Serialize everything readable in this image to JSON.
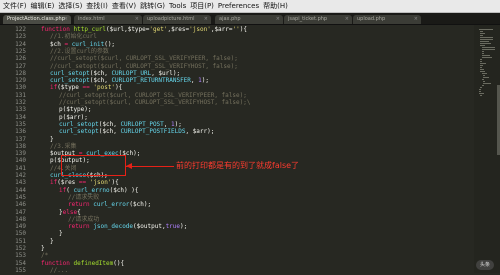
{
  "menu": [
    "文件(F)",
    "编辑(E)",
    "选择(S)",
    "查找(I)",
    "查看(V)",
    "跳转(G)",
    "Tools",
    "项目(P)",
    "Preferences",
    "帮助(H)"
  ],
  "tabs": [
    {
      "label": "ProjectAction.class.php",
      "active": true
    },
    {
      "label": "index.html",
      "active": false
    },
    {
      "label": "uploadpicture.html",
      "active": false
    },
    {
      "label": "ajax.php",
      "active": false
    },
    {
      "label": "jsapi_ticket.php",
      "active": false
    },
    {
      "label": "upload.php",
      "active": false
    }
  ],
  "line_numbers": [
    "122",
    "123",
    "124",
    "125",
    "126",
    "127",
    "128",
    "129",
    "130",
    "131",
    "132",
    "133",
    "134",
    "135",
    "136",
    "137",
    "138",
    "139",
    "140",
    "141",
    "142",
    "143",
    "144",
    "145",
    "146",
    "147",
    "148",
    "149",
    "150",
    "151",
    "152",
    "153",
    "154",
    "155"
  ],
  "code": [
    {
      "indent": 1,
      "parts": [
        [
          "k",
          "function "
        ],
        [
          "fn",
          "http_curl"
        ],
        [
          "p",
          "($url,$type="
        ],
        [
          "s",
          "'get'"
        ],
        [
          "p",
          ",$res="
        ],
        [
          "s",
          "'json'"
        ],
        [
          "p",
          ",$arr="
        ],
        [
          "s",
          "''"
        ],
        [
          "p",
          "){"
        ]
      ]
    },
    {
      "indent": 2,
      "parts": [
        [
          "c",
          "//1.初始化curl"
        ]
      ]
    },
    {
      "indent": 2,
      "parts": [
        [
          "v",
          "$ch "
        ],
        [
          "k",
          "= "
        ],
        [
          "f",
          "curl_init"
        ],
        [
          "p",
          "();"
        ]
      ]
    },
    {
      "indent": 2,
      "parts": [
        [
          "c",
          "//2.设置curl的参数"
        ]
      ]
    },
    {
      "indent": 2,
      "parts": [
        [
          "c",
          "//curl_setopt($curl, CURLOPT_SSL_VERIFYPEER, false);"
        ]
      ]
    },
    {
      "indent": 2,
      "parts": [
        [
          "c",
          "//curl_setopt($curl, CURLOPT_SSL_VERIFYHOST, false);"
        ]
      ]
    },
    {
      "indent": 2,
      "parts": [
        [
          "f",
          "curl_setopt"
        ],
        [
          "p",
          "($ch, "
        ],
        [
          "f",
          "CURLOPT_URL"
        ],
        [
          "p",
          ", $url);"
        ]
      ]
    },
    {
      "indent": 2,
      "parts": [
        [
          "f",
          "curl_setopt"
        ],
        [
          "p",
          "($ch, "
        ],
        [
          "f",
          "CURLOPT_RETURNTRANSFER"
        ],
        [
          "p",
          ", "
        ],
        [
          "n",
          "1"
        ],
        [
          "p",
          ");"
        ]
      ]
    },
    {
      "indent": 2,
      "parts": [
        [
          "k",
          "if"
        ],
        [
          "p",
          "($type "
        ],
        [
          "k",
          "== "
        ],
        [
          "s",
          "'post'"
        ],
        [
          "p",
          "){"
        ]
      ]
    },
    {
      "indent": 3,
      "parts": [
        [
          "c",
          "//curl_setopt($curl, CURLOPT_SSL_VERIFYPEER, false);"
        ]
      ]
    },
    {
      "indent": 3,
      "parts": [
        [
          "c",
          "//curl_setopt($curl, CURLOPT_SSL_VERIFYHOST, false);\\"
        ]
      ]
    },
    {
      "indent": 3,
      "parts": [
        [
          "v",
          "p($type);"
        ]
      ]
    },
    {
      "indent": 3,
      "parts": [
        [
          "v",
          "p($arr);"
        ]
      ]
    },
    {
      "indent": 3,
      "parts": [
        [
          "f",
          "curl_setopt"
        ],
        [
          "p",
          "($ch, "
        ],
        [
          "f",
          "CURLOPT_POST"
        ],
        [
          "p",
          ", "
        ],
        [
          "n",
          "1"
        ],
        [
          "p",
          ");"
        ]
      ]
    },
    {
      "indent": 3,
      "parts": [
        [
          "f",
          "curl_setopt"
        ],
        [
          "p",
          "($ch, "
        ],
        [
          "f",
          "CURLOPT_POSTFIELDS"
        ],
        [
          "p",
          ", $arr);"
        ]
      ]
    },
    {
      "indent": 2,
      "parts": [
        [
          "p",
          "}"
        ]
      ]
    },
    {
      "indent": 2,
      "parts": [
        [
          "c",
          "//3.采集"
        ]
      ]
    },
    {
      "indent": 2,
      "parts": [
        [
          "v",
          "$output "
        ],
        [
          "k",
          "= "
        ],
        [
          "f",
          "curl_exec"
        ],
        [
          "p",
          "($ch);"
        ]
      ]
    },
    {
      "indent": 2,
      "parts": [
        [
          "v",
          "p($output);"
        ]
      ]
    },
    {
      "indent": 2,
      "parts": [
        [
          "c",
          "//4.关闭"
        ]
      ]
    },
    {
      "indent": 2,
      "parts": [
        [
          "f",
          "curl_close"
        ],
        [
          "p",
          "($ch);"
        ]
      ]
    },
    {
      "indent": 2,
      "parts": [
        [
          "k",
          "if"
        ],
        [
          "p",
          "($res "
        ],
        [
          "k",
          "== "
        ],
        [
          "s",
          "'json'"
        ],
        [
          "p",
          "){"
        ]
      ]
    },
    {
      "indent": 3,
      "parts": [
        [
          "k",
          "if"
        ],
        [
          "p",
          "( "
        ],
        [
          "f",
          "curl_errno"
        ],
        [
          "p",
          "($ch) ){"
        ]
      ]
    },
    {
      "indent": 4,
      "parts": [
        [
          "c",
          "//请求失败"
        ]
      ]
    },
    {
      "indent": 4,
      "parts": [
        [
          "k",
          "return "
        ],
        [
          "f",
          "curl_error"
        ],
        [
          "p",
          "($ch);"
        ]
      ]
    },
    {
      "indent": 3,
      "parts": [
        [
          "p",
          "}"
        ],
        [
          "k",
          "else"
        ],
        [
          "p",
          "{"
        ]
      ]
    },
    {
      "indent": 4,
      "parts": [
        [
          "c",
          "//请求成功"
        ]
      ]
    },
    {
      "indent": 4,
      "parts": [
        [
          "k",
          "return "
        ],
        [
          "f",
          "json_decode"
        ],
        [
          "p",
          "($output,"
        ],
        [
          "n",
          "true"
        ],
        [
          "p",
          ");"
        ]
      ]
    },
    {
      "indent": 3,
      "parts": [
        [
          "p",
          "}"
        ]
      ]
    },
    {
      "indent": 2,
      "parts": [
        [
          "p",
          "}"
        ]
      ]
    },
    {
      "indent": 1,
      "parts": [
        [
          "p",
          "}"
        ]
      ]
    },
    {
      "indent": 1,
      "parts": [
        [
          "c",
          "/*"
        ]
      ]
    },
    {
      "indent": 1,
      "parts": [
        [
          "k",
          "function "
        ],
        [
          "fn",
          "definedItem"
        ],
        [
          "p",
          "(){"
        ]
      ]
    },
    {
      "indent": 2,
      "parts": [
        [
          "c",
          "//..."
        ]
      ]
    }
  ],
  "annotation": "前的打印都是有的到了就成false了",
  "watermark": "头条"
}
